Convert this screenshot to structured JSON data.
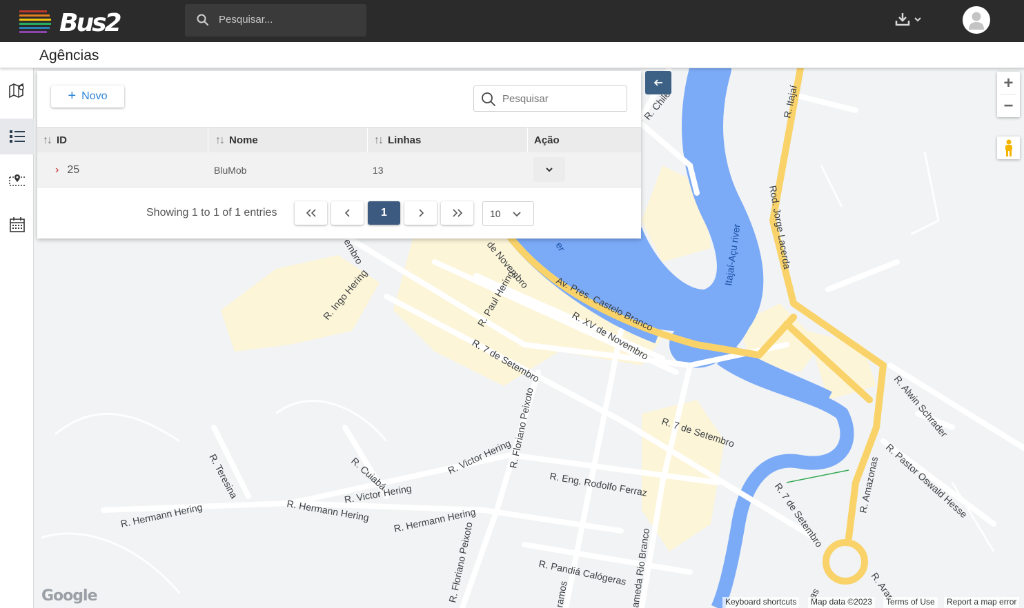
{
  "app": {
    "logo_text": "Bus2",
    "search_placeholder": "Pesquisar...",
    "page_title": "Agências"
  },
  "sidebar": {
    "items": [
      {
        "icon": "map-icon",
        "active": false
      },
      {
        "icon": "list-icon",
        "active": true
      },
      {
        "icon": "route-icon",
        "active": false
      },
      {
        "icon": "calendar-icon",
        "active": false
      }
    ]
  },
  "panel": {
    "new_label": "Novo",
    "search_placeholder": "Pesquisar",
    "columns": {
      "id": "ID",
      "name": "Nome",
      "lines": "Linhas",
      "action": "Ação"
    },
    "rows": [
      {
        "id": "25",
        "name": "BluMob",
        "lines": "13"
      }
    ],
    "pagination": {
      "info": "Showing 1 to 1 of 1 entries",
      "first": "<<",
      "prev": "<",
      "current": "1",
      "next": ">",
      "last": ">>",
      "page_size": "10"
    }
  },
  "map": {
    "labels": [
      "R. Chile",
      "R. Itajaí",
      "Rod. Jorge Lacerda",
      "Itajaí-Açu river",
      "Av. Pres. Castelo Branco",
      "R. XV de Novembro",
      "de Novembro",
      "R. Paul Hering",
      "R. Ingo Hering",
      "R. 7 de Setembro",
      "R. Floriano Peixoto",
      "R. Alwin Schrader",
      "R. Pastor Oswald Hesse",
      "R. Amazonas",
      "R. Victor Hering",
      "R. Cuiabá",
      "R. Teresina",
      "R. Hermann Hering",
      "R. Eng. Rodolfo Ferraz",
      "R. Pandiá Calógeras",
      "ameda Rio Branco",
      "R. Arar",
      "ramos",
      "embro",
      "er",
      "as"
    ],
    "attribution": {
      "shortcuts": "Keyboard shortcuts",
      "data": "Map data ©2023",
      "terms": "Terms of Use",
      "report": "Report a map error"
    },
    "google": "Google"
  },
  "colors": {
    "topbar": "#2b2b2b",
    "accent_blue": "#2e84d6",
    "pager_active": "#3c5a80",
    "collapse_btn": "#3d6184",
    "river": "#7baaf7",
    "main_road": "#f9d36a"
  }
}
